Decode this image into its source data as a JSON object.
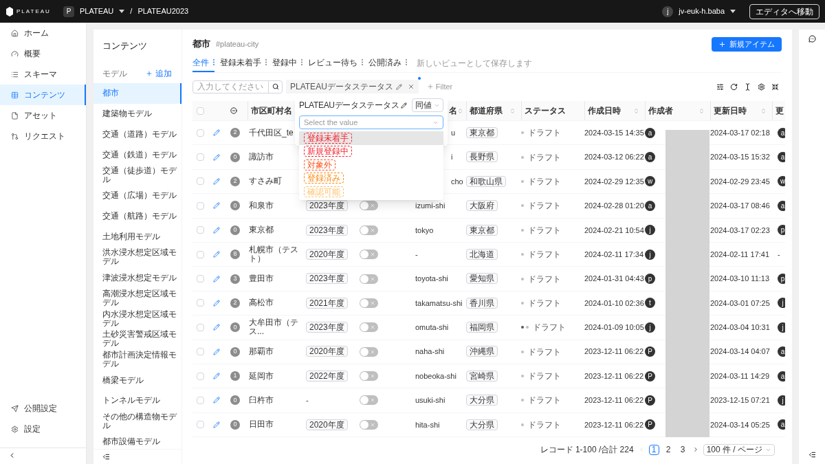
{
  "topbar": {
    "logo": "PLATEAU",
    "workspace_initial": "P",
    "workspace": "PLATEAU",
    "separator": "/",
    "project": "PLATEAU2023",
    "user_initial": "j",
    "user": "jv-euk-h.baba",
    "editor_button": "エディタへ移動"
  },
  "sidebar": {
    "items": [
      {
        "label": "ホーム",
        "selected": false
      },
      {
        "label": "概要",
        "selected": false
      },
      {
        "label": "スキーマ",
        "selected": false
      },
      {
        "label": "コンテンツ",
        "selected": true
      },
      {
        "label": "アセット",
        "selected": false
      },
      {
        "label": "リクエスト",
        "selected": false
      }
    ],
    "bottom_items": [
      {
        "label": "公開設定",
        "selected": false
      },
      {
        "label": "設定",
        "selected": false
      }
    ]
  },
  "models": {
    "title": "コンテンツ",
    "label": "モデル",
    "add": "追加",
    "items": [
      {
        "label": "都市",
        "selected": true
      },
      {
        "label": "建築物モデル",
        "selected": false
      },
      {
        "label": "交通（道路）モデル",
        "selected": false
      },
      {
        "label": "交通（鉄道）モデル",
        "selected": false
      },
      {
        "label": "交通（徒歩道）モデル",
        "selected": false
      },
      {
        "label": "交通（広場）モデル",
        "selected": false
      },
      {
        "label": "交通（航路）モデル",
        "selected": false
      },
      {
        "label": "土地利用モデル",
        "selected": false
      },
      {
        "label": "洪水浸水想定区域モデル",
        "selected": false
      },
      {
        "label": "津波浸水想定モデル",
        "selected": false
      },
      {
        "label": "高潮浸水想定区域モデル",
        "selected": false
      },
      {
        "label": "内水浸水想定区域モデル",
        "selected": false
      },
      {
        "label": "土砂災害警戒区域モデル",
        "selected": false
      },
      {
        "label": "都市計画決定情報モデル",
        "selected": false
      },
      {
        "label": "橋梁モデル",
        "selected": false
      },
      {
        "label": "トンネルモデル",
        "selected": false
      },
      {
        "label": "その他の構造物モデル",
        "selected": false
      },
      {
        "label": "都市設備モデル",
        "selected": false
      }
    ]
  },
  "header": {
    "title": "都市",
    "key": "#plateau-city",
    "new_button": "新規アイテム"
  },
  "views": [
    {
      "label": "全件",
      "selected": true
    },
    {
      "label": "登録未着手",
      "selected": false
    },
    {
      "label": "登録中",
      "selected": false
    },
    {
      "label": "レビュー待ち",
      "selected": false
    },
    {
      "label": "公開済み",
      "selected": false
    }
  ],
  "save_view": "新しいビューとして保存します",
  "search": {
    "placeholder": "入力してください"
  },
  "filter_chip": {
    "label": "PLATEAUデータステータス",
    "unsaved": true
  },
  "add_filter": "Filter",
  "filter_popup": {
    "field": "PLATEAUデータステータス",
    "operator": "同値",
    "value_placeholder": "Select the value",
    "options": [
      {
        "label": "登録未着手",
        "color": "#f5222d",
        "highlighted": true
      },
      {
        "label": "新規登録中",
        "color": "#f5222d",
        "highlighted": false
      },
      {
        "label": "対象外",
        "color": "#fa541c",
        "highlighted": false
      },
      {
        "label": "登録済み",
        "color": "#fa8c16",
        "highlighted": false
      },
      {
        "label": "確認可能",
        "color": "#ffc069",
        "highlighted": false
      }
    ]
  },
  "table": {
    "select_all_checked": false,
    "columns": [
      {
        "label": "市区町村名",
        "sortable": false,
        "covered": false
      },
      {
        "label": "名",
        "sortable": true,
        "covered": true
      },
      {
        "label": "都道府県",
        "sortable": true,
        "covered": false
      },
      {
        "label": "ステータス",
        "sortable": false,
        "covered": false
      },
      {
        "label": "作成日時",
        "sortable": true,
        "covered": false
      },
      {
        "label": "作成者",
        "sortable": true,
        "covered": false
      },
      {
        "label": "更新日時",
        "sortable": true,
        "covered": false
      },
      {
        "label": "更"
      }
    ],
    "rows": [
      {
        "checked": false,
        "name": "千代田区_te",
        "count": "2",
        "romaji": "u",
        "covered": true,
        "prefecture": "東京都",
        "status": "ドラフト",
        "status_dots": [
          {
            "color": "#bfbfbf"
          }
        ],
        "created": "2024-03-15 14:35",
        "creator": "a",
        "updated": "2024-03-17 02:18",
        "updater": {
          "kind": "avatar",
          "text": "a"
        }
      },
      {
        "checked": false,
        "name": "諏訪市",
        "count": "0",
        "romaji": "i",
        "covered": true,
        "prefecture": "長野県",
        "status": "ドラフト",
        "status_dots": [
          {
            "color": "#bfbfbf"
          }
        ],
        "created": "2024-03-12 06:22",
        "creator": "a",
        "updated": "2024-03-15 15:32",
        "updater": {
          "kind": "avatar",
          "text": "a"
        }
      },
      {
        "checked": false,
        "name": "すさみ町",
        "count": "2",
        "romaji": "cho",
        "covered": true,
        "prefecture": "和歌山県",
        "status": "ドラフト",
        "status_dots": [
          {
            "color": "#bfbfbf"
          }
        ],
        "created": "2024-02-29 12:35",
        "creator": "w",
        "updated": "2024-02-29 23:45",
        "updater": {
          "kind": "avatar",
          "text": "w"
        }
      },
      {
        "checked": false,
        "name": "和泉市",
        "count": "0",
        "year": "2023年度",
        "toggle": {
          "on": false
        },
        "romaji": "izumi-shi",
        "covered": false,
        "prefecture": "大阪府",
        "status": "ドラフト",
        "status_dots": [
          {
            "color": "#bfbfbf"
          }
        ],
        "created": "2024-02-28 01:20",
        "creator": "a",
        "updated": "2024-03-17 08:46",
        "updater": {
          "kind": "avatar",
          "text": "a"
        }
      },
      {
        "checked": false,
        "name": "東京都",
        "count": "0",
        "year": "2023年度",
        "toggle": {
          "on": false
        },
        "romaji": "tokyo",
        "covered": false,
        "prefecture": "東京都",
        "status": "ドラフト",
        "status_dots": [
          {
            "color": "#bfbfbf"
          }
        ],
        "created": "2024-02-21 10:54",
        "creator": "j",
        "updated": "2024-03-17 02:23",
        "updater": {
          "kind": "avatar",
          "text": "p"
        }
      },
      {
        "checked": false,
        "name": "札幌市（テスト）",
        "count": "8",
        "year": "2020年度",
        "toggle": {
          "on": false
        },
        "romaji": "-",
        "prefecture": "北海道",
        "status": "ドラフト",
        "status_dots": [
          {
            "color": "#bfbfbf"
          }
        ],
        "created": "2024-02-11 17:34",
        "creator": "j",
        "updated": "2024-02-11 17:41",
        "updater": {
          "kind": "text",
          "text": "-"
        }
      },
      {
        "checked": false,
        "name": "豊田市",
        "count": "3",
        "year": "2023年度",
        "toggle": {
          "on": false
        },
        "romaji": "toyota-shi",
        "covered": false,
        "prefecture": "愛知県",
        "status": "ドラフト",
        "status_dots": [
          {
            "color": "#bfbfbf"
          }
        ],
        "created": "2024-01-31 04:43",
        "creator": "p",
        "updated": "2024-03-10 11:13",
        "updater": {
          "kind": "avatar",
          "text": "p"
        }
      },
      {
        "checked": false,
        "name": "高松市",
        "count": "2",
        "year": "2021年度",
        "toggle": {
          "on": false
        },
        "romaji": "takamatsu-shi",
        "covered": false,
        "prefecture": "香川県",
        "status": "ドラフト",
        "status_dots": [
          {
            "color": "#bfbfbf"
          }
        ],
        "created": "2024-01-10 02:36",
        "creator": "t",
        "updated": "2024-03-01 07:25",
        "updater": {
          "kind": "avatar",
          "text": "j"
        }
      },
      {
        "checked": false,
        "name": "大牟田市（テス...",
        "count": "0",
        "year": "2023年度",
        "toggle": {
          "on": false
        },
        "romaji": "omuta-shi",
        "covered": false,
        "prefecture": "福岡県",
        "status": "ドラフト",
        "status_dots": [
          {
            "color": "#595959"
          },
          {
            "color": "#bfbfbf"
          }
        ],
        "created": "2024-01-09 10:05",
        "creator": "j",
        "updated": "2024-03-04 10:31",
        "updater": {
          "kind": "avatar",
          "text": "j"
        }
      },
      {
        "checked": false,
        "name": "那覇市",
        "count": "0",
        "year": "2020年度",
        "toggle": {
          "on": false
        },
        "romaji": "naha-shi",
        "covered": false,
        "prefecture": "沖縄県",
        "status": "ドラフト",
        "status_dots": [
          {
            "color": "#bfbfbf"
          }
        ],
        "created": "2023-12-11 06:22",
        "creator": "P",
        "updated": "2024-03-14 04:07",
        "updater": {
          "kind": "avatar",
          "text": "a"
        }
      },
      {
        "checked": false,
        "name": "延岡市",
        "count": "1",
        "year": "2022年度",
        "toggle": {
          "on": false
        },
        "romaji": "nobeoka-shi",
        "covered": false,
        "prefecture": "宮崎県",
        "status": "ドラフト",
        "status_dots": [
          {
            "color": "#bfbfbf"
          }
        ],
        "created": "2023-12-11 06:22",
        "creator": "P",
        "updated": "2024-03-11 14:29",
        "updater": {
          "kind": "avatar",
          "text": "a"
        }
      },
      {
        "checked": false,
        "name": "臼杵市",
        "count": "0",
        "year": "-",
        "toggle": {
          "on": false
        },
        "romaji": "usuki-shi",
        "covered": false,
        "prefecture": "大分県",
        "status": "ドラフト",
        "status_dots": [
          {
            "color": "#bfbfbf"
          }
        ],
        "created": "2023-12-11 06:22",
        "creator": "P",
        "updated": "2023-12-15 07:21",
        "updater": {
          "kind": "avatar",
          "text": "j"
        }
      },
      {
        "checked": false,
        "name": "日田市",
        "count": "0",
        "year": "2020年度",
        "toggle": {
          "on": false
        },
        "romaji": "hita-shi",
        "covered": false,
        "prefecture": "大分県",
        "status": "ドラフト",
        "status_dots": [
          {
            "color": "#bfbfbf"
          }
        ],
        "created": "2023-12-11 06:22",
        "creator": "P",
        "updated": "2024-03-14 05:25",
        "updater": {
          "kind": "avatar",
          "text": "a"
        }
      }
    ]
  },
  "pagination": {
    "summary": "レコード 1-100 /合計 224",
    "pages": [
      {
        "label": "1",
        "selected": true
      },
      {
        "label": "2",
        "selected": false
      },
      {
        "label": "3",
        "selected": false
      }
    ],
    "page_size": "100 件 / ページ"
  }
}
